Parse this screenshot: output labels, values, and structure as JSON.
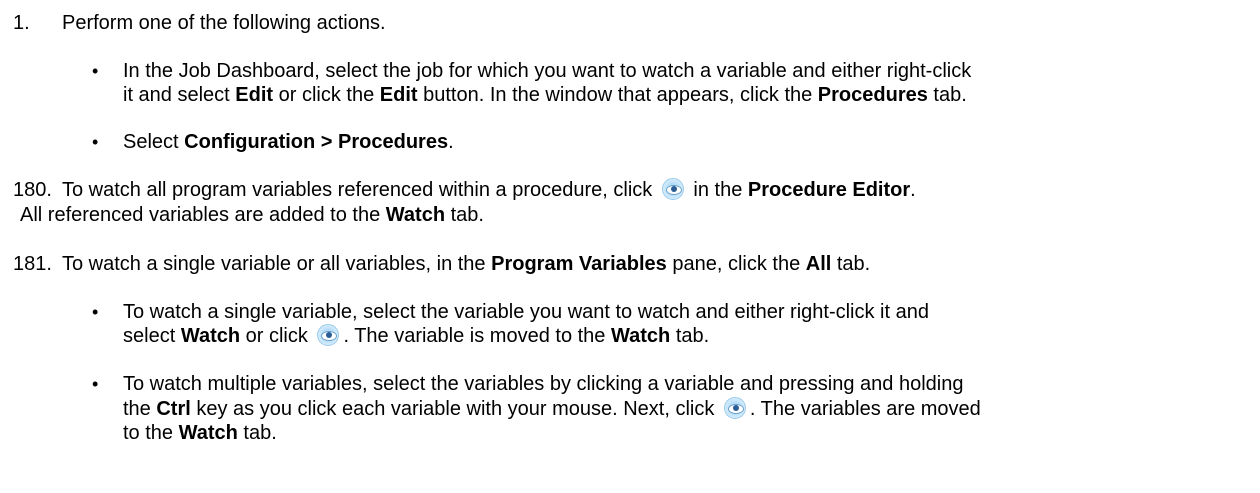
{
  "steps": {
    "s1": {
      "num": "1.",
      "text": "Perform one of the following actions.",
      "bullets": {
        "b1": {
          "p1": "In the Job Dashboard, select the job for which you want to watch a variable and either right-click",
          "p2": "it and select ",
          "edit1": "Edit",
          "p3": " or click the ",
          "edit2": "Edit",
          "p4": " button. In the window that appears, click the ",
          "procedures": "Procedures",
          "p5": " tab."
        },
        "b2": {
          "p1": "Select ",
          "config": "Configuration > Procedures",
          "p2": "."
        }
      }
    },
    "s180": {
      "num": "180.",
      "p1": "To watch all program variables referenced within a procedure, click",
      "p2": " in the ",
      "procedure_editor": "Procedure Editor",
      "p3": ".",
      "p4": "All  referenced variables are added to the ",
      "watch": "Watch",
      "p5": " tab."
    },
    "s181": {
      "num": "181.",
      "p1": "To watch a single variable or all variables, in the ",
      "program_variables": "Program Variables",
      "p2": " pane, click the ",
      "all": "All",
      "p3": " tab.",
      "bullets": {
        "b1": {
          "p1": "To watch a single variable, select the variable you want to watch and either right-click it and",
          "p2": "select ",
          "watch1": "Watch",
          "p3": " or click",
          "p4": ". The variable is moved to the ",
          "watch2": "Watch",
          "p5": " tab."
        },
        "b2": {
          "p1": "To watch multiple variables, select the variables by clicking a variable and pressing and holding",
          "p2": "the ",
          "ctrl": "Ctrl",
          "p3": " key as you click each variable with your mouse. Next, click",
          "p4": ". The variables are moved",
          "p5": "to the ",
          "watch": "Watch",
          "p6": " tab."
        }
      }
    }
  },
  "bullet_glyph": "•",
  "icons": {
    "watch": "eye-icon"
  }
}
